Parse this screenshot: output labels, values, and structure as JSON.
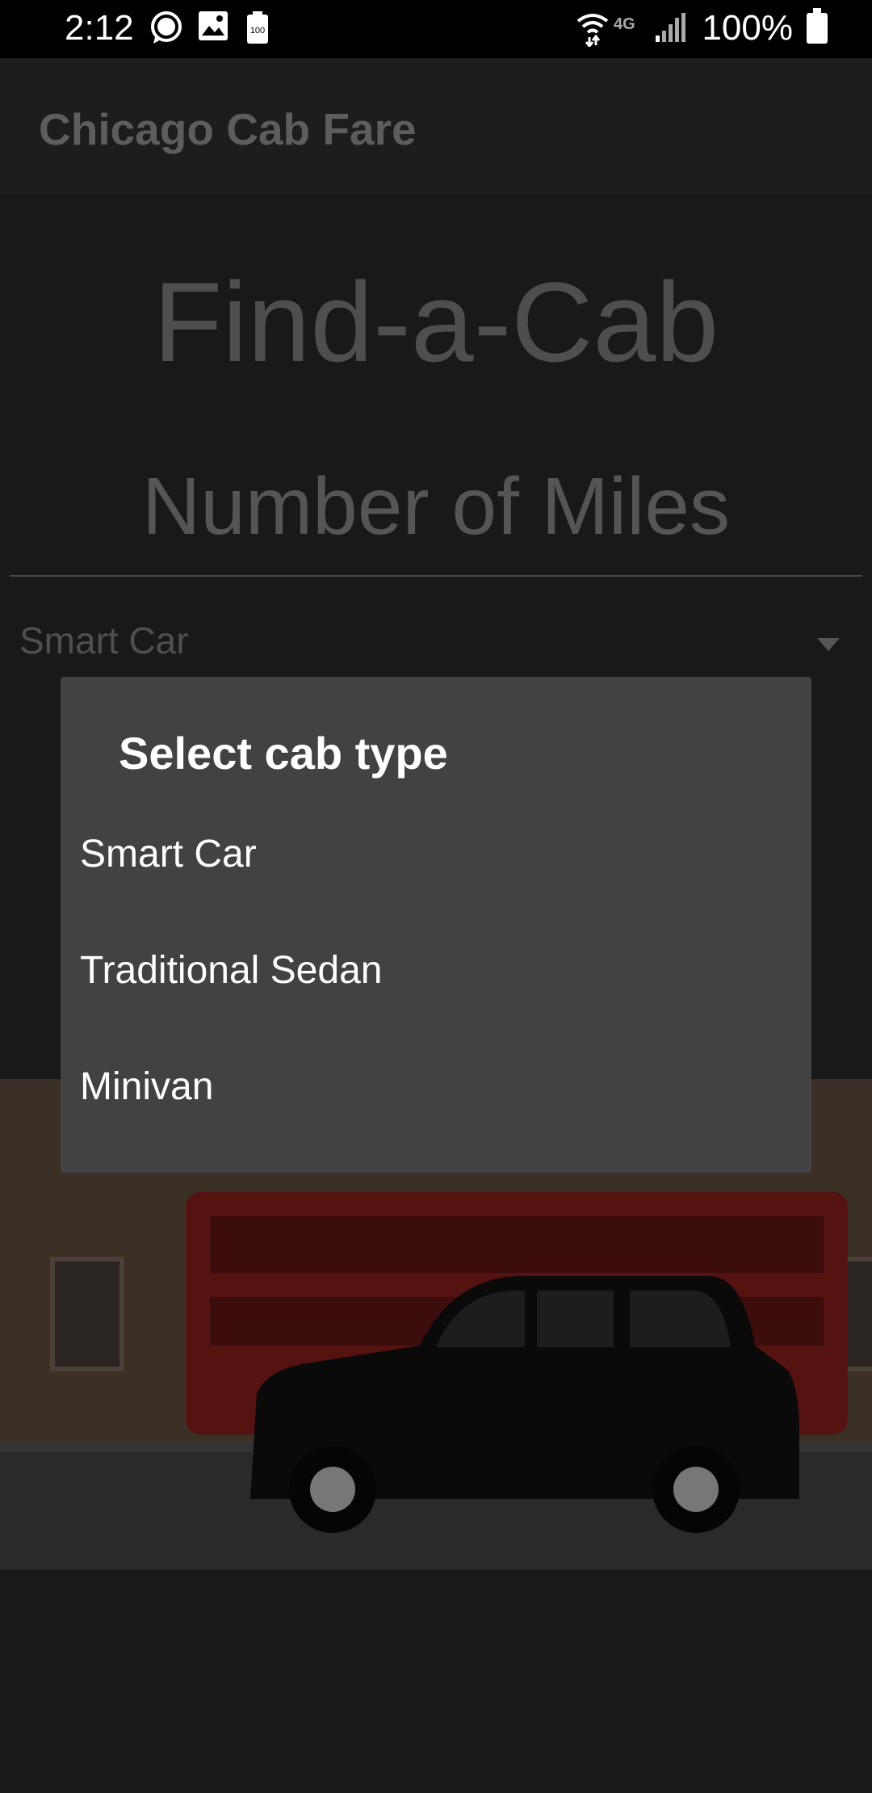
{
  "status_bar": {
    "time": "2:12",
    "battery_text": "100%",
    "icons": [
      "chat-bubble-icon",
      "image-icon",
      "battery-100-icon",
      "wifi-icon",
      "4g-lte-icon",
      "signal-icon",
      "battery-icon"
    ],
    "battery_small_label": "100",
    "network_label": "4G"
  },
  "app_bar": {
    "title": "Chicago Cab Fare"
  },
  "main": {
    "heading": "Find-a-Cab",
    "miles_placeholder": "Number of Miles",
    "spinner_selected": "Smart Car"
  },
  "dialog": {
    "title": "Select cab type",
    "options": [
      "Smart Car",
      "Traditional Sedan",
      "Minivan"
    ]
  },
  "colors": {
    "dialog_bg": "#424242",
    "status_bar": "#000000",
    "app_bar": "#1d1d1d"
  }
}
